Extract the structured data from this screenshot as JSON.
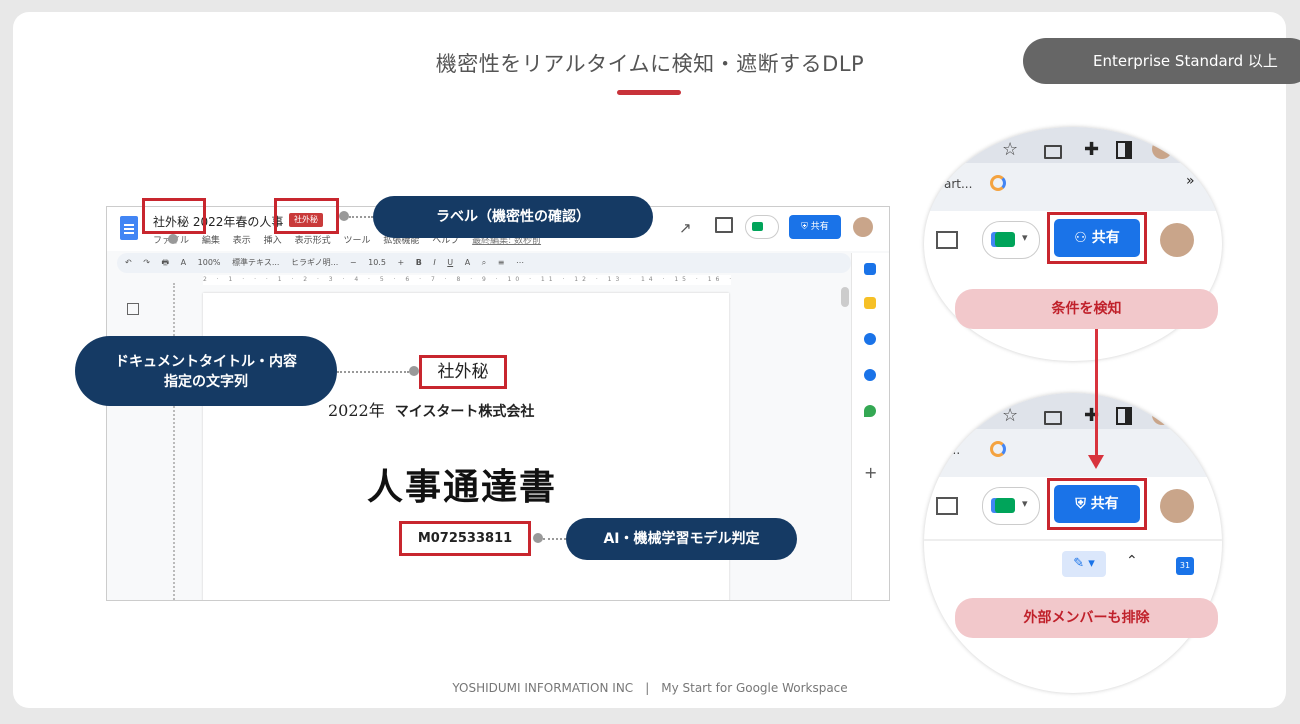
{
  "slide": {
    "title": "機密性をリアルタイムに検知・遮断するDLP",
    "edition_badge": "Enterprise Standard 以上",
    "footer": "YOSHIDUMI INFORMATION INC　|　My Start for Google Workspace"
  },
  "doc_window": {
    "title": "社外秘 2022年春の人事",
    "label_chip": "社外秘",
    "menu": [
      "ファイル",
      "編集",
      "表示",
      "挿入",
      "表示形式",
      "ツール",
      "拡張機能",
      "ヘルプ",
      "最終編集: 数秒前"
    ],
    "toolbar": [
      "↶",
      "↷",
      "🖶",
      "A",
      "100%",
      "標準テキス...",
      "ヒラギノ明...",
      "−",
      "10.5",
      "+",
      "B",
      "I",
      "U",
      "A",
      "⌕",
      "≡",
      "⋯"
    ],
    "ruler": "2 · 1 · · · 1 · 2 · 3 · 4 · 5 · 6 · 7 · 8 · 9 · 10 · 11 · 12 · 13 · 14 · 15 · 16 · 17 · 18",
    "share_label": "共有",
    "page": {
      "label": "社外秘",
      "subtitle_year": "2022年",
      "company": "マイスタート株式会社",
      "heading": "人事通達書",
      "code": "M072533811"
    }
  },
  "callouts": {
    "label": "ラベル（機密性の確認）",
    "doc_line1": "ドキュメントタイトル・内容",
    "doc_line2": "指定の文字列",
    "ai": "AI・機械学習モデル判定"
  },
  "zoom_top": {
    "bookmark": "art...",
    "share_label": "共有",
    "chevron": "»"
  },
  "zoom_bottom": {
    "bookmark": "t...",
    "share_label": "共有",
    "calendar": "31"
  },
  "pills": {
    "detect": "条件を検知",
    "remove": "外部メンバーも排除"
  },
  "icons": [
    "docs-logo-icon",
    "trend-icon",
    "comment-icon",
    "meet-icon",
    "shield-icon",
    "people-icon",
    "star-icon",
    "puzzle-icon",
    "side-panel-icon",
    "pencil-icon",
    "calendar-icon"
  ],
  "colors": {
    "accent_red": "#c8262e",
    "navy": "#153a64",
    "share_blue": "#1a73e8",
    "pill_pink": "#f2c8cb"
  }
}
